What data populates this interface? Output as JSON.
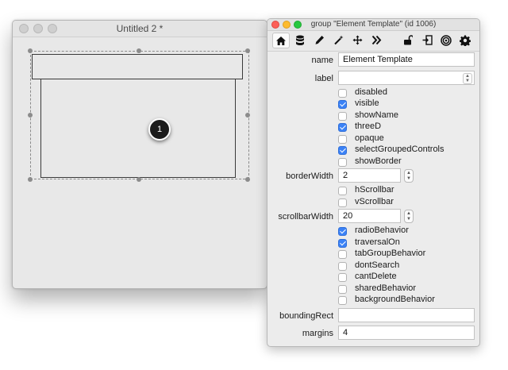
{
  "card_window": {
    "title": "Untitled 2 *",
    "badge": "1"
  },
  "inspector": {
    "title": "group \"Element Template\" (id 1006)",
    "toolbar_icons": [
      "home-icon",
      "database-icon",
      "pencil-icon",
      "wand-icon",
      "move-icon",
      "forward-icon",
      "lock-icon",
      "exit-icon",
      "target-icon",
      "gear-icon"
    ],
    "fields": {
      "name": {
        "label": "name",
        "value": "Element Template"
      },
      "label": {
        "label": "label",
        "value": ""
      },
      "borderWidth": {
        "label": "borderWidth",
        "value": "2"
      },
      "scrollbarWidth": {
        "label": "scrollbarWidth",
        "value": "20"
      },
      "boundingRect": {
        "label": "boundingRect",
        "value": ""
      },
      "margins": {
        "label": "margins",
        "value": "4"
      }
    },
    "checkboxes_group1": [
      {
        "label": "disabled",
        "checked": false
      },
      {
        "label": "visible",
        "checked": true
      },
      {
        "label": "showName",
        "checked": false
      },
      {
        "label": "threeD",
        "checked": true
      },
      {
        "label": "opaque",
        "checked": false
      },
      {
        "label": "selectGroupedControls",
        "checked": true
      },
      {
        "label": "showBorder",
        "checked": false
      }
    ],
    "checkboxes_group2": [
      {
        "label": "hScrollbar",
        "checked": false
      },
      {
        "label": "vScrollbar",
        "checked": false
      }
    ],
    "checkboxes_group3": [
      {
        "label": "radioBehavior",
        "checked": true
      },
      {
        "label": "traversalOn",
        "checked": true
      },
      {
        "label": "tabGroupBehavior",
        "checked": false
      },
      {
        "label": "dontSearch",
        "checked": false
      },
      {
        "label": "cantDelete",
        "checked": false
      },
      {
        "label": "sharedBehavior",
        "checked": false
      },
      {
        "label": "backgroundBehavior",
        "checked": false
      }
    ],
    "colors": {
      "accent": "#3b82f6"
    }
  }
}
